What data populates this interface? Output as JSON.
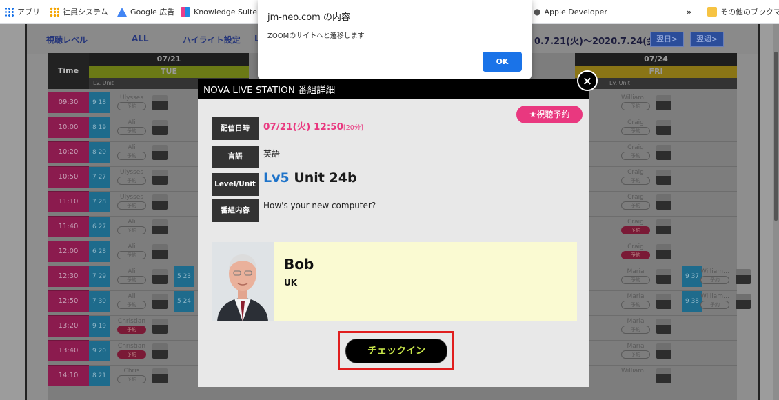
{
  "bookmarks": {
    "items": [
      {
        "label": "アプリ",
        "icon": "apps-grid-icon"
      },
      {
        "label": "社員システム",
        "icon": "dots-grid-icon"
      },
      {
        "label": "Google 広告",
        "icon": "google-ads-icon"
      },
      {
        "label": "Knowledge Suite",
        "icon": "knowledge-suite-icon"
      },
      {
        "label": "Apple Developer",
        "icon": "apple-icon"
      }
    ],
    "overflow": "»",
    "other_label": "その他のブックマーク"
  },
  "alert": {
    "title": "jm-neo.com の内容",
    "message": "ZOOMのサイトへと遷移します",
    "ok_label": "OK"
  },
  "page": {
    "level_label": "視聴レベル",
    "level_value": "ALL",
    "highlight_label": "ハイライト設定",
    "highlight_value": "Lv",
    "date_range": "0.7.21(火)～2020.7.24(金)",
    "next_day": "翌日>",
    "next_week": "翌週>",
    "time_header": "Time",
    "unit_label": "Lv. Unit",
    "days": [
      {
        "date": "07/21",
        "weekday": "TUE",
        "color": "#6b7a16"
      },
      {
        "date": "07/24",
        "weekday": "FRI",
        "color": "#8a7516"
      }
    ],
    "times": [
      "09:30",
      "10:00",
      "10:20",
      "10:50",
      "11:10",
      "11:40",
      "12:00",
      "12:30",
      "12:50",
      "13:20",
      "13:40",
      "14:10"
    ],
    "tue_rows": [
      {
        "lv": "9",
        "unit": "18",
        "name": "Ulysses",
        "badge": "予約"
      },
      {
        "lv": "8",
        "unit": "19",
        "name": "Ali",
        "badge": "予約"
      },
      {
        "lv": "8",
        "unit": "20",
        "name": "Ali",
        "badge": "予約"
      },
      {
        "lv": "7",
        "unit": "27",
        "name": "Ulysses",
        "badge": "予約"
      },
      {
        "lv": "7",
        "unit": "28",
        "name": "Ulysses",
        "badge": "予約"
      },
      {
        "lv": "6",
        "unit": "27",
        "name": "Ali",
        "badge": "予約"
      },
      {
        "lv": "6",
        "unit": "28",
        "name": "Ali",
        "badge": "予約"
      },
      {
        "lv": "7",
        "unit": "29",
        "name": "Ali",
        "badge": "予約"
      },
      {
        "lv": "7",
        "unit": "30",
        "name": "Ali",
        "badge": "予約"
      },
      {
        "lv": "9",
        "unit": "19",
        "name": "Christian",
        "badge": "予約"
      },
      {
        "lv": "9",
        "unit": "20",
        "name": "Christian",
        "badge": "予約"
      },
      {
        "lv": "8",
        "unit": "21",
        "name": "Chris",
        "badge": "予約"
      }
    ],
    "tue_extra": [
      {
        "row": 7,
        "lv": "5",
        "unit": "23"
      },
      {
        "row": 8,
        "lv": "5",
        "unit": "24"
      }
    ],
    "fri_rows": [
      {
        "name": "William…",
        "badge": "予約"
      },
      {
        "name": "Craig",
        "badge": "予約"
      },
      {
        "name": "Craig",
        "badge": "予約"
      },
      {
        "name": "Craig",
        "badge": "予約"
      },
      {
        "name": "Craig",
        "badge": "予約"
      },
      {
        "name": "Craig",
        "badge": "予約"
      },
      {
        "name": "Craig",
        "badge": "予約"
      },
      {
        "name": "Maria",
        "badge": "予約"
      },
      {
        "name": "Maria",
        "badge": "予約"
      },
      {
        "name": "Maria",
        "badge": "予約"
      },
      {
        "name": "Maria",
        "badge": "予約"
      },
      {
        "name": "William…",
        "badge": ""
      }
    ],
    "fri_extra": [
      {
        "row": 7,
        "lv": "9",
        "unit": "37",
        "name": "William…",
        "badge": "予約"
      },
      {
        "row": 8,
        "lv": "9",
        "unit": "38",
        "name": "William…",
        "badge": "予約"
      }
    ]
  },
  "modal": {
    "title": "NOVA LIVE STATION 番組詳細",
    "close_symbol": "×",
    "reserve_label": "★視聴予約",
    "fields": {
      "date_label": "配信日時",
      "date_value": "07/21(火) 12:50",
      "duration": "[20分]",
      "language_label": "言語",
      "language_value": "英語",
      "level_label": "Level/Unit",
      "level_value": "Lv5",
      "unit_value": "Unit 24b",
      "content_label": "番組内容",
      "content_value": "How's your new computer?"
    },
    "teacher": {
      "name": "Bob",
      "country": "UK"
    },
    "checkin_label": "チェックイン"
  }
}
